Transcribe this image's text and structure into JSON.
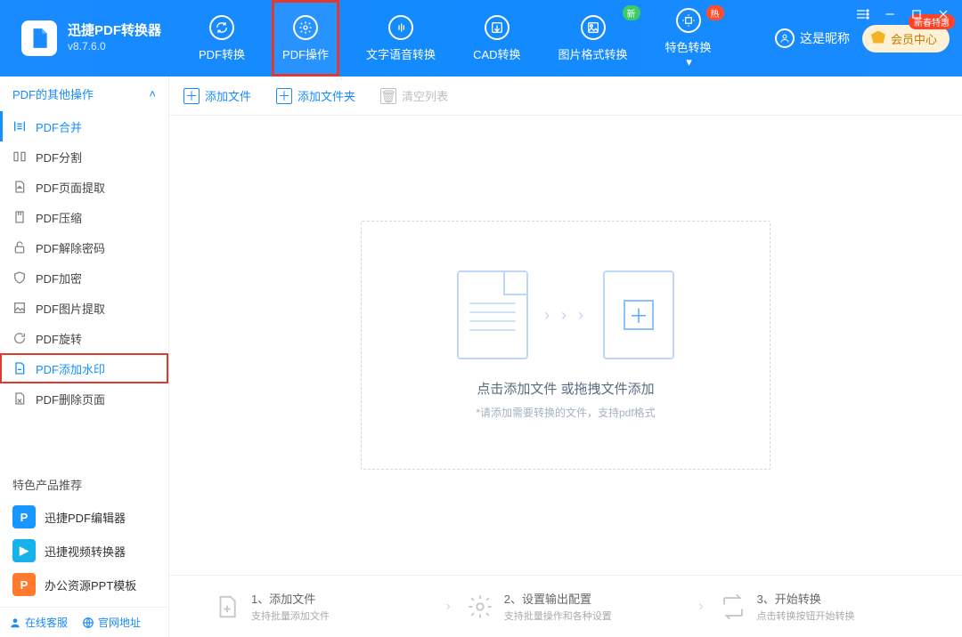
{
  "app": {
    "title": "迅捷PDF转换器",
    "version": "v8.7.6.0"
  },
  "nav": {
    "items": [
      {
        "label": "PDF转换"
      },
      {
        "label": "PDF操作"
      },
      {
        "label": "文字语音转换"
      },
      {
        "label": "CAD转换"
      },
      {
        "label": "图片格式转换",
        "tag": "新",
        "tagClass": "green"
      },
      {
        "label": "特色转换",
        "tag": "热",
        "tagClass": "red"
      }
    ],
    "active": 1
  },
  "user": {
    "nickname": "这是昵称"
  },
  "vip": {
    "label": "会员中心",
    "tag": "新春特惠"
  },
  "sidebar": {
    "header": "PDF的其他操作",
    "items": [
      {
        "label": "PDF合并"
      },
      {
        "label": "PDF分割"
      },
      {
        "label": "PDF页面提取"
      },
      {
        "label": "PDF压缩"
      },
      {
        "label": "PDF解除密码"
      },
      {
        "label": "PDF加密"
      },
      {
        "label": "PDF图片提取"
      },
      {
        "label": "PDF旋转"
      },
      {
        "label": "PDF添加水印"
      },
      {
        "label": "PDF删除页面"
      }
    ],
    "active": 0,
    "highlight": 8
  },
  "promo": {
    "title": "特色产品推荐",
    "items": [
      {
        "label": "迅捷PDF编辑器",
        "color": "blue",
        "glyph": "P"
      },
      {
        "label": "迅捷视频转换器",
        "color": "teal",
        "glyph": "▶"
      },
      {
        "label": "办公资源PPT模板",
        "color": "orange",
        "glyph": "P"
      }
    ]
  },
  "bottomlinks": {
    "support": "在线客服",
    "site": "官网地址"
  },
  "toolbar": {
    "add_file": "添加文件",
    "add_folder": "添加文件夹",
    "clear": "清空列表"
  },
  "drop": {
    "title": "点击添加文件 或拖拽文件添加",
    "sub": "*请添加需要转换的文件，支持pdf格式"
  },
  "steps": [
    {
      "title": "1、添加文件",
      "sub": "支持批量添加文件"
    },
    {
      "title": "2、设置输出配置",
      "sub": "支持批量操作和各种设置"
    },
    {
      "title": "3、开始转换",
      "sub": "点击转换按钮开始转换"
    }
  ]
}
